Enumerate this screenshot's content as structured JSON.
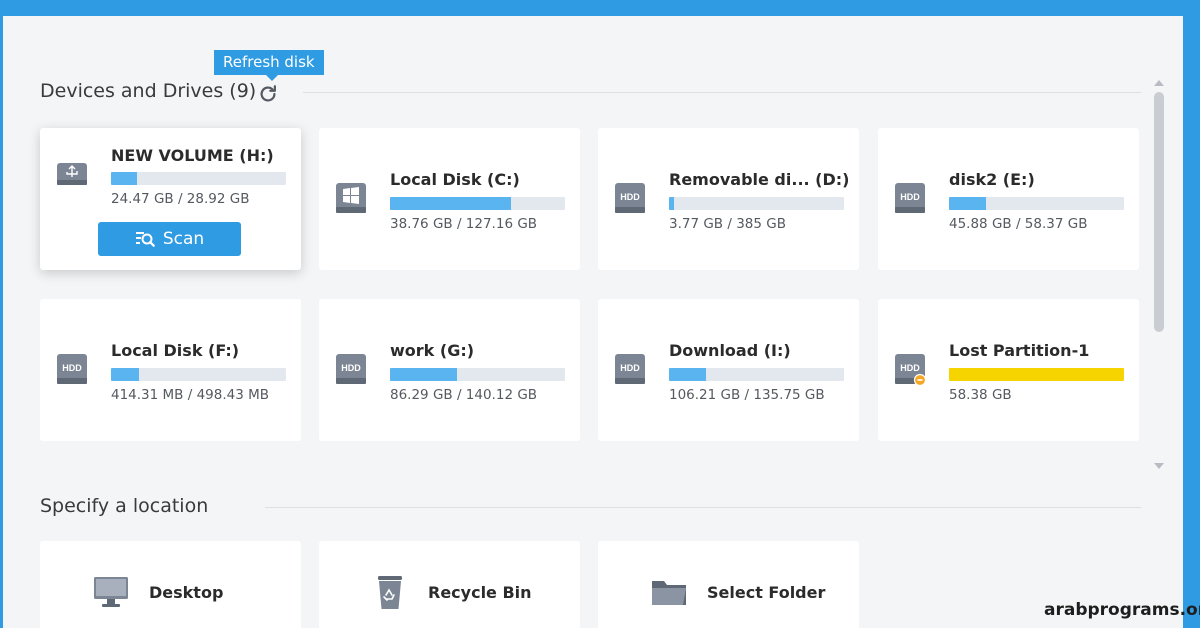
{
  "devices_section": {
    "title": "Devices and Drives (9)",
    "refresh_tooltip": "Refresh disk"
  },
  "drives": [
    {
      "name": "NEW VOLUME  (H:)",
      "size": "24.47 GB / 28.92 GB",
      "used_fraction": 0.15,
      "icon": "usb-drive-icon",
      "bar_color": "#5ab4f0",
      "selected": true
    },
    {
      "name": "Local Disk (C:)",
      "size": "38.76 GB / 127.16 GB",
      "used_fraction": 0.69,
      "icon": "windows-drive-icon",
      "bar_color": "#5ab4f0"
    },
    {
      "name": "Removable di... (D:)",
      "size": "3.77 GB /  385 GB",
      "used_fraction": 0.03,
      "icon": "hdd-icon",
      "bar_color": "#5ab4f0"
    },
    {
      "name": "disk2 (E:)",
      "size": "45.88 GB / 58.37 GB",
      "used_fraction": 0.21,
      "icon": "hdd-icon",
      "bar_color": "#5ab4f0"
    },
    {
      "name": "Local Disk (F:)",
      "size": "414.31 MB / 498.43 MB",
      "used_fraction": 0.16,
      "icon": "hdd-icon",
      "bar_color": "#5ab4f0"
    },
    {
      "name": "work (G:)",
      "size": "86.29 GB / 140.12 GB",
      "used_fraction": 0.38,
      "icon": "hdd-icon",
      "bar_color": "#5ab4f0"
    },
    {
      "name": "Download (I:)",
      "size": "106.21 GB / 135.75 GB",
      "used_fraction": 0.21,
      "icon": "hdd-icon",
      "bar_color": "#5ab4f0"
    },
    {
      "name": "Lost Partition-1",
      "size": "58.38 GB",
      "used_fraction": 1.0,
      "icon": "lost-partition-hdd-icon",
      "bar_color": "#f5d400"
    }
  ],
  "scan_button": {
    "label": "Scan"
  },
  "location_section": {
    "title": "Specify a location",
    "items": [
      {
        "label": "Desktop",
        "icon": "desktop-icon"
      },
      {
        "label": "Recycle Bin",
        "icon": "recycle-bin-icon"
      },
      {
        "label": "Select Folder",
        "icon": "folder-icon"
      }
    ]
  },
  "watermark": "arabprograms.org",
  "colors": {
    "accent": "#2f9be3",
    "bar_fill": "#5ab4f0",
    "lost_bar": "#f5d400",
    "background": "#f4f5f7"
  }
}
